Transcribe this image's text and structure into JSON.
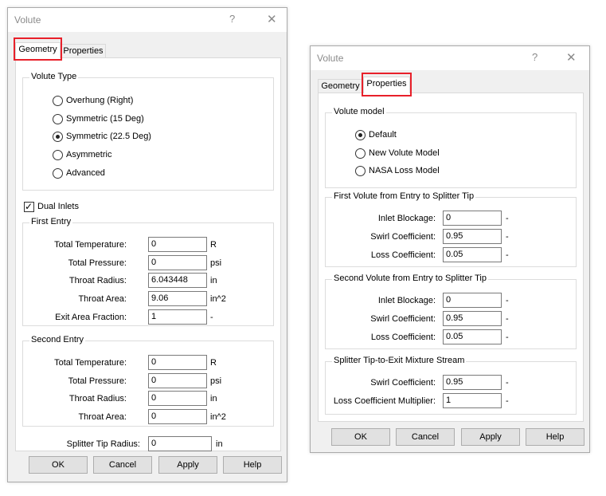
{
  "geometry_dialog": {
    "title": "Volute",
    "help_icon": "?",
    "close_icon": "✕",
    "tabs": [
      {
        "label": "Geometry",
        "active": true
      },
      {
        "label": "Properties",
        "active": false
      }
    ],
    "volute_type": {
      "label": "Volute Type",
      "options": [
        {
          "label": "Overhung (Right)",
          "selected": false
        },
        {
          "label": "Symmetric (15 Deg)",
          "selected": false
        },
        {
          "label": "Symmetric (22.5 Deg)",
          "selected": true
        },
        {
          "label": "Asymmetric",
          "selected": false
        },
        {
          "label": "Advanced",
          "selected": false
        }
      ]
    },
    "dual_inlets": {
      "label": "Dual Inlets",
      "checked": true
    },
    "first_entry": {
      "label": "First Entry",
      "fields": [
        {
          "label": "Total Temperature:",
          "value": "0",
          "unit": "R"
        },
        {
          "label": "Total Pressure:",
          "value": "0",
          "unit": "psi"
        },
        {
          "label": "Throat Radius:",
          "value": "6.043448",
          "unit": "in"
        },
        {
          "label": "Throat Area:",
          "value": "9.06",
          "unit": "in^2"
        },
        {
          "label": "Exit Area Fraction:",
          "value": "1",
          "unit": "-"
        }
      ]
    },
    "second_entry": {
      "label": "Second Entry",
      "fields": [
        {
          "label": "Total Temperature:",
          "value": "0",
          "unit": "R"
        },
        {
          "label": "Total Pressure:",
          "value": "0",
          "unit": "psi"
        },
        {
          "label": "Throat Radius:",
          "value": "0",
          "unit": "in"
        },
        {
          "label": "Throat Area:",
          "value": "0",
          "unit": "in^2"
        }
      ]
    },
    "splitter_tip_radius": {
      "label": "Splitter Tip Radius:",
      "value": "0",
      "unit": "in"
    },
    "buttons": {
      "ok": "OK",
      "cancel": "Cancel",
      "apply": "Apply",
      "help": "Help"
    }
  },
  "properties_dialog": {
    "title": "Volute",
    "help_icon": "?",
    "close_icon": "✕",
    "tabs": [
      {
        "label": "Geometry",
        "active": false
      },
      {
        "label": "Properties",
        "active": true
      }
    ],
    "volute_model": {
      "label": "Volute model",
      "options": [
        {
          "label": "Default",
          "selected": true
        },
        {
          "label": "New Volute Model",
          "selected": false
        },
        {
          "label": "NASA Loss Model",
          "selected": false
        }
      ]
    },
    "first_volute": {
      "label": "First Volute from Entry to Splitter Tip",
      "fields": [
        {
          "label": "Inlet Blockage:",
          "value": "0",
          "unit": "-"
        },
        {
          "label": "Swirl Coefficient:",
          "value": "0.95",
          "unit": "-"
        },
        {
          "label": "Loss Coefficient:",
          "value": "0.05",
          "unit": "-"
        }
      ]
    },
    "second_volute": {
      "label": "Second Volute from Entry to Splitter Tip",
      "fields": [
        {
          "label": "Inlet Blockage:",
          "value": "0",
          "unit": "-"
        },
        {
          "label": "Swirl Coefficient:",
          "value": "0.95",
          "unit": "-"
        },
        {
          "label": "Loss Coefficient:",
          "value": "0.05",
          "unit": "-"
        }
      ]
    },
    "mixture_stream": {
      "label": "Splitter Tip-to-Exit Mixture Stream",
      "fields": [
        {
          "label": "Swirl Coefficient:",
          "value": "0.95",
          "unit": "-"
        },
        {
          "label": "Loss Coefficient Multiplier:",
          "value": "1",
          "unit": "-"
        }
      ]
    },
    "buttons": {
      "ok": "OK",
      "cancel": "Cancel",
      "apply": "Apply",
      "help": "Help"
    }
  },
  "colors": {
    "highlight": "#e8202a",
    "dialog_bg": "#f0f0f0",
    "panel_bg": "#ffffff"
  }
}
